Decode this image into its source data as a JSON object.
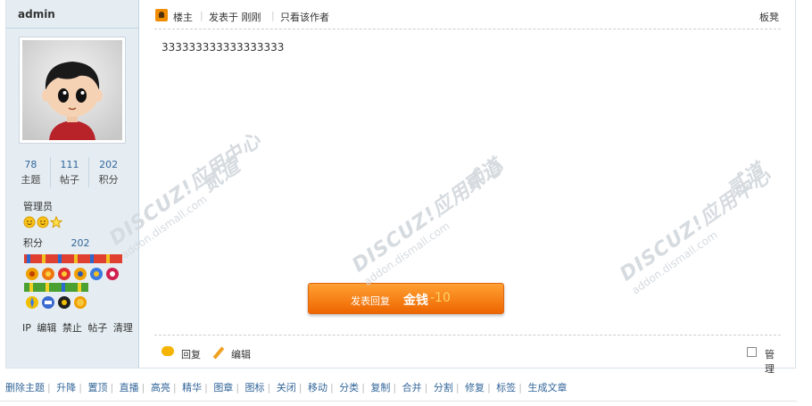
{
  "author": {
    "name": "admin",
    "stats": [
      {
        "num": "78",
        "label": "主题"
      },
      {
        "num": "111",
        "label": "帖子"
      },
      {
        "num": "202",
        "label": "积分"
      }
    ],
    "group": "管理员",
    "credit_label": "积分",
    "credit_value": "202",
    "actions": [
      "IP",
      "编辑",
      "禁止",
      "帖子",
      "清理"
    ]
  },
  "post": {
    "host_label": "楼主",
    "posted_at": "发表于 刚刚",
    "only_author": "只看该作者",
    "floor": "板凳",
    "content": "333333333333333333",
    "reply_button_label": "发表回复",
    "reply_money": "金钱",
    "reply_cost": "-10",
    "reply_link": "回复",
    "edit_link": "编辑",
    "manage_label": "管理"
  },
  "watermark": {
    "brand": "DISCUZ!应用中心",
    "sub": "addon.dismall.com",
    "mark": "贰道"
  },
  "admin_bar": [
    "删除主题",
    "升降",
    "置顶",
    "直播",
    "高亮",
    "精华",
    "图章",
    "图标",
    "关闭",
    "移动",
    "分类",
    "复制",
    "合并",
    "分割",
    "修复",
    "标签",
    "生成文章"
  ],
  "colors": {
    "sidebar_bg": "#e5edf2",
    "link": "#336699",
    "reply_button": "#f07800"
  }
}
